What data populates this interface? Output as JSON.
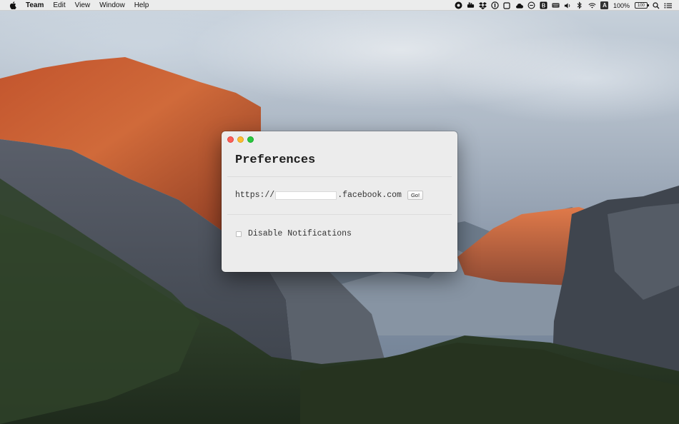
{
  "menubar": {
    "app_name": "Team",
    "items": [
      "Edit",
      "View",
      "Window",
      "Help"
    ],
    "battery_percent": "100%",
    "battery_icon_text": "100",
    "input_source": "A",
    "status_icons": [
      "app-icon-1",
      "app-icon-2",
      "dropbox-icon",
      "onepassword-icon",
      "square-icon",
      "cloud-icon",
      "sync-icon",
      "bold-b-icon",
      "keyboard-icon",
      "volume-icon",
      "bluetooth-icon",
      "wifi-icon",
      "input-source-icon",
      "battery-icon",
      "spotlight-icon",
      "notification-center-icon"
    ]
  },
  "window": {
    "title": "Preferences",
    "url_prefix": "https://",
    "url_value": "",
    "url_suffix": ".facebook.com",
    "go_label": "Go!",
    "notifications_label": "Disable Notifications",
    "notifications_checked": false
  },
  "colors": {
    "window_bg": "#ececec",
    "close": "#fc5f57",
    "minimize": "#fdbc2e",
    "maximize": "#28c840"
  }
}
